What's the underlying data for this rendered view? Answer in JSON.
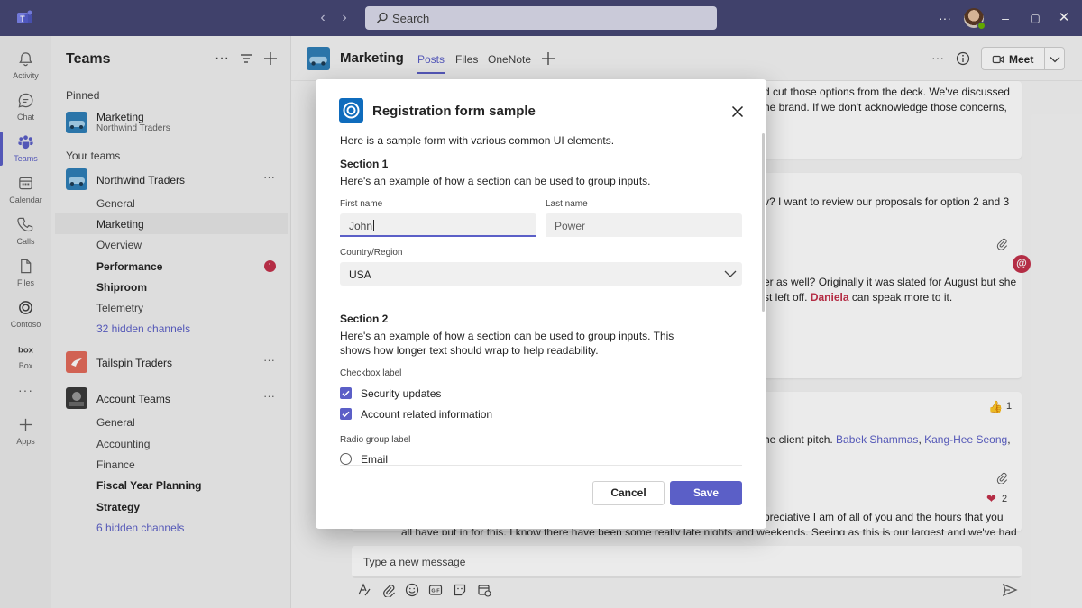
{
  "titlebar": {
    "search_placeholder": "Search"
  },
  "rail": [
    {
      "label": "Activity",
      "icon": "bell-icon"
    },
    {
      "label": "Chat",
      "icon": "chat-icon"
    },
    {
      "label": "Teams",
      "icon": "teams-icon"
    },
    {
      "label": "Calendar",
      "icon": "calendar-icon"
    },
    {
      "label": "Calls",
      "icon": "phone-icon"
    },
    {
      "label": "Files",
      "icon": "file-icon"
    },
    {
      "label": "Contoso",
      "icon": "contoso-icon"
    },
    {
      "label": "Box",
      "icon": "box-icon"
    },
    {
      "label": "Apps",
      "icon": "plus-icon"
    }
  ],
  "panel": {
    "title": "Teams",
    "pinned_label": "Pinned",
    "pinned": {
      "name": "Marketing",
      "sub": "Northwind Traders"
    },
    "your_teams_label": "Your teams",
    "teams": [
      {
        "name": "Northwind Traders"
      },
      {
        "name": "Tailspin Traders"
      },
      {
        "name": "Account Teams"
      }
    ],
    "northwind_channels": [
      "General",
      "Marketing",
      "Overview",
      "Performance",
      "Shiproom",
      "Telemetry",
      "32 hidden channels"
    ],
    "performance_badge": "1",
    "account_channels": [
      "General",
      "Accounting",
      "Finance",
      "Fiscal Year Planning",
      "Strategy",
      "6 hidden channels"
    ]
  },
  "channel": {
    "title": "Marketing",
    "tabs": [
      "Posts",
      "Files",
      "OneNote"
    ],
    "meet_label": "Meet"
  },
  "posts": {
    "p1_line1": "d cut those options from the deck. We've discussed",
    "p1_line2": "ne brand. If we don't acknowledge those concerns,",
    "p2_line1": "v? I want to review our proposals for option 2 and 3",
    "p2_line2": "er as well? Originally it was slated for August but she",
    "p2_line3_a": "st left off. ",
    "p2_line3_mention": "Daniela",
    "p2_line3_b": " can speak more to it.",
    "like_count": "1",
    "p3_line1_a": "he client pitch. ",
    "p3_mention1": "Babek Shammas",
    "p3_sep": ", ",
    "p3_mention2": "Kang-Hee Seong",
    "p3_tail": ",",
    "heart_count": "2",
    "p4_line1": "preciative I am of all of you and the hours that you",
    "p4_line2": "all have put in for this. I know there have been some really late nights and weekends. Seeing as this is our largest and we've had"
  },
  "composer": {
    "placeholder": "Type a new message"
  },
  "dialog": {
    "title": "Registration form sample",
    "intro": "Here is a sample form with various common UI elements.",
    "section1": {
      "heading": "Section 1",
      "desc": "Here's an example of how a section can be used to group inputs.",
      "first_name_label": "First name",
      "first_name_value": "John",
      "last_name_label": "Last name",
      "last_name_value": "Power",
      "country_label": "Country/Region",
      "country_value": "USA"
    },
    "section2": {
      "heading": "Section 2",
      "desc_line1": "Here's an example of how a section can be used to group inputs. This",
      "desc_line2": "shows how longer text should wrap to help readability.",
      "checkbox_group_label": "Checkbox label",
      "checkbox1": "Security updates",
      "checkbox2": "Account related information",
      "radio_group_label": "Radio group label",
      "radio1": "Email"
    },
    "cancel_label": "Cancel",
    "save_label": "Save"
  },
  "colors": {
    "titlebar": "#464775",
    "brand": "#5b5fc7",
    "alert": "#c4314b",
    "dialog_logo": "#0f6cbd"
  }
}
